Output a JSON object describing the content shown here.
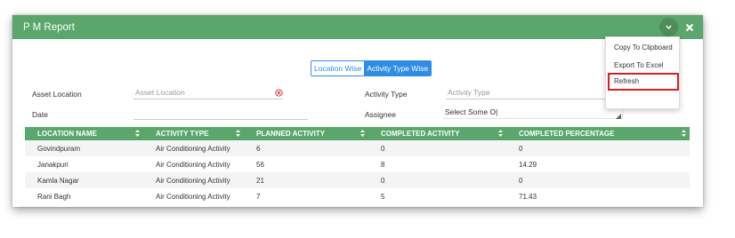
{
  "window": {
    "title": "P M Report"
  },
  "icons": {
    "collapse": "chevron-down-icon",
    "close": "close-icon",
    "clear": "clear-circle-icon",
    "sort": "sort-icon",
    "resize": "resize-handle-icon"
  },
  "colors": {
    "header": "#5aa66c",
    "accent": "#2f8de4",
    "clear": "#d61f26",
    "highlight": "#d61f26"
  },
  "toggle": {
    "location_wise": "Location Wise",
    "activity_type_wise": "Activity Type Wise",
    "selected": "Activity Type Wise"
  },
  "filters": {
    "asset_location": {
      "label": "Asset Location",
      "placeholder": "Asset Location",
      "value": ""
    },
    "activity_type": {
      "label": "Activity Type",
      "placeholder": "Activity Type",
      "value": ""
    },
    "date": {
      "label": "Date",
      "value": ""
    },
    "assignee": {
      "label": "Assignee",
      "value": "Select Some O|"
    }
  },
  "table": {
    "columns": [
      "LOCATION NAME",
      "ACTIVITY TYPE",
      "PLANNED ACTIVITY",
      "COMPLETED ACTIVITY",
      "COMPLETED PERCENTAGE"
    ],
    "rows": [
      [
        "Govindpuram",
        "Air Conditioning Activity",
        "6",
        "0",
        "0"
      ],
      [
        "Janakpuri",
        "Air Conditioning Activity",
        "56",
        "8",
        "14.29"
      ],
      [
        "Kamla Nagar",
        "Air Conditioning Activity",
        "21",
        "0",
        "0"
      ],
      [
        "Rani Bagh",
        "Air Conditioning Activity",
        "7",
        "5",
        "71.43"
      ]
    ]
  },
  "menu": {
    "items": [
      "Copy To Clipboard",
      "Export To Excel",
      "Refresh"
    ],
    "highlighted": "Export To Excel"
  }
}
